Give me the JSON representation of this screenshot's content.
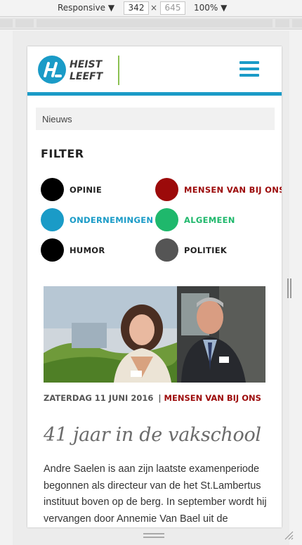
{
  "devtools": {
    "device": "Responsive",
    "width": "342",
    "separator": "×",
    "height": "645",
    "zoom": "100%"
  },
  "site": {
    "logo_line1": "HEIST",
    "logo_line2": "LEEFT",
    "menu_icon": "hamburger-icon",
    "brand_blue": "#1a9bc7",
    "brand_green": "#8cc152"
  },
  "breadcrumb": "Nieuws",
  "filter": {
    "title": "FILTER",
    "items": [
      {
        "label": "OPINIE",
        "color": "#000000",
        "text_color": "#222222"
      },
      {
        "label": "MENSEN VAN BIJ ONS",
        "color": "#9c0a0a",
        "text_color": "#9c0a0a"
      },
      {
        "label": "ONDERNEMINGEN",
        "color": "#1a9bc7",
        "text_color": "#1a9bc7"
      },
      {
        "label": "ALGEMEEN",
        "color": "#1fb86c",
        "text_color": "#1fb86c"
      },
      {
        "label": "HUMOR",
        "color": "#000000",
        "text_color": "#222222"
      },
      {
        "label": "POLITIEK",
        "color": "#555555",
        "text_color": "#222222"
      }
    ]
  },
  "article": {
    "date": "ZATERDAG 11 JUNI 2016",
    "separator": "|",
    "category": "MENSEN VAN BIJ ONS",
    "title": "41 jaar in de vakschool",
    "body": "Andre Saelen is aan zijn laatste examenperiode begonnen als directeur van de het St.Lambertus instituut boven op de berg.  In september wordt hij vervangen door Annemie Van Bael uit de"
  }
}
